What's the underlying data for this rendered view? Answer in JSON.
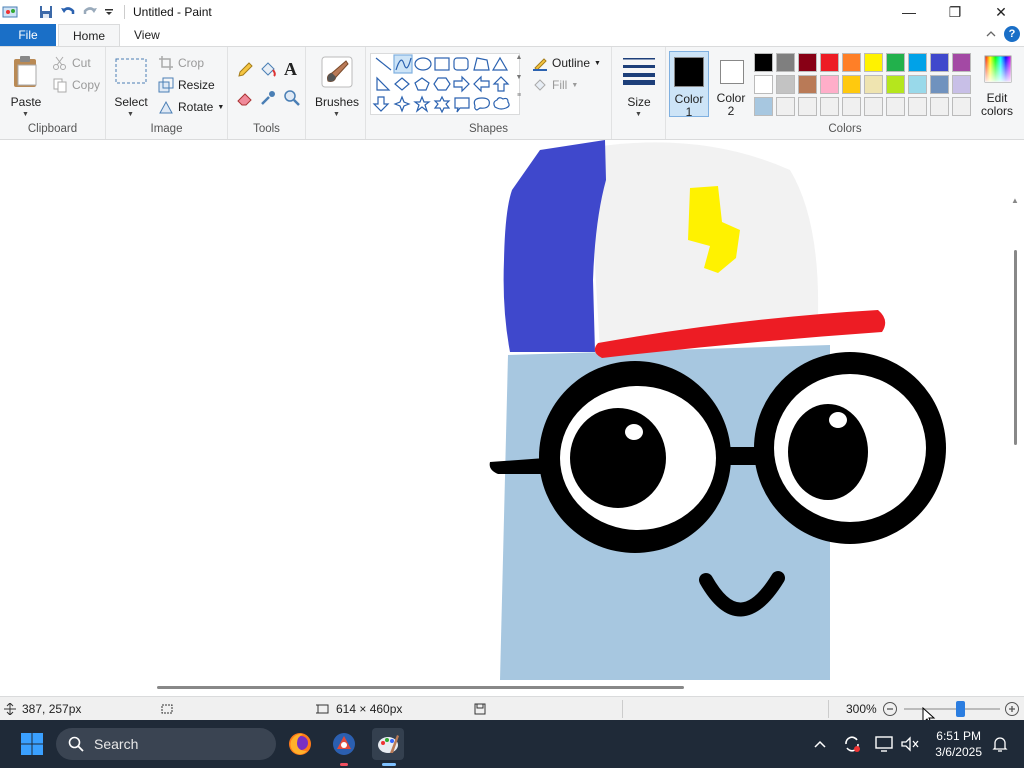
{
  "window": {
    "title": "Untitled - Paint",
    "minimize": "—",
    "maximize": "❐",
    "close": "✕"
  },
  "tabs": {
    "file": "File",
    "home": "Home",
    "view": "View"
  },
  "ribbon": {
    "clipboard": {
      "paste": "Paste",
      "cut": "Cut",
      "copy": "Copy",
      "label": "Clipboard"
    },
    "image": {
      "select": "Select",
      "crop": "Crop",
      "resize": "Resize",
      "rotate": "Rotate",
      "label": "Image"
    },
    "tools": {
      "label": "Tools",
      "text_glyph": "A"
    },
    "brushes": {
      "label": "Brushes"
    },
    "shapes": {
      "outline": "Outline",
      "fill": "Fill",
      "label": "Shapes"
    },
    "size": {
      "label": "Size"
    },
    "colors": {
      "color1_line1": "Color",
      "color1_line2": "1",
      "color2_line1": "Color",
      "color2_line2": "2",
      "edit_line1": "Edit",
      "edit_line2": "colors",
      "label": "Colors",
      "color1": "#000000",
      "color2": "#ffffff",
      "palette_row1": [
        "#000000",
        "#7f7f7f",
        "#880015",
        "#ed1c24",
        "#ff7f27",
        "#fff200",
        "#22b14c",
        "#00a2e8",
        "#3f48cc",
        "#a349a4"
      ],
      "palette_row2": [
        "#ffffff",
        "#c3c3c3",
        "#b97a57",
        "#ffaec9",
        "#ffc90e",
        "#efe4b0",
        "#b5e61d",
        "#99d9ea",
        "#7092be",
        "#c8bfe7"
      ],
      "palette_row3": [
        "#a7c7e0",
        "#f0f0f0",
        "#f0f0f0",
        "#f0f0f0",
        "#f0f0f0",
        "#f0f0f0",
        "#f0f0f0",
        "#f0f0f0",
        "#f0f0f0",
        "#f0f0f0"
      ]
    }
  },
  "status": {
    "cursor_pos": "387, 257px",
    "image_size": "614 × 460px",
    "zoom": "300%"
  },
  "taskbar": {
    "search": "Search",
    "time": "6:51 PM",
    "date": "3/6/2025"
  }
}
